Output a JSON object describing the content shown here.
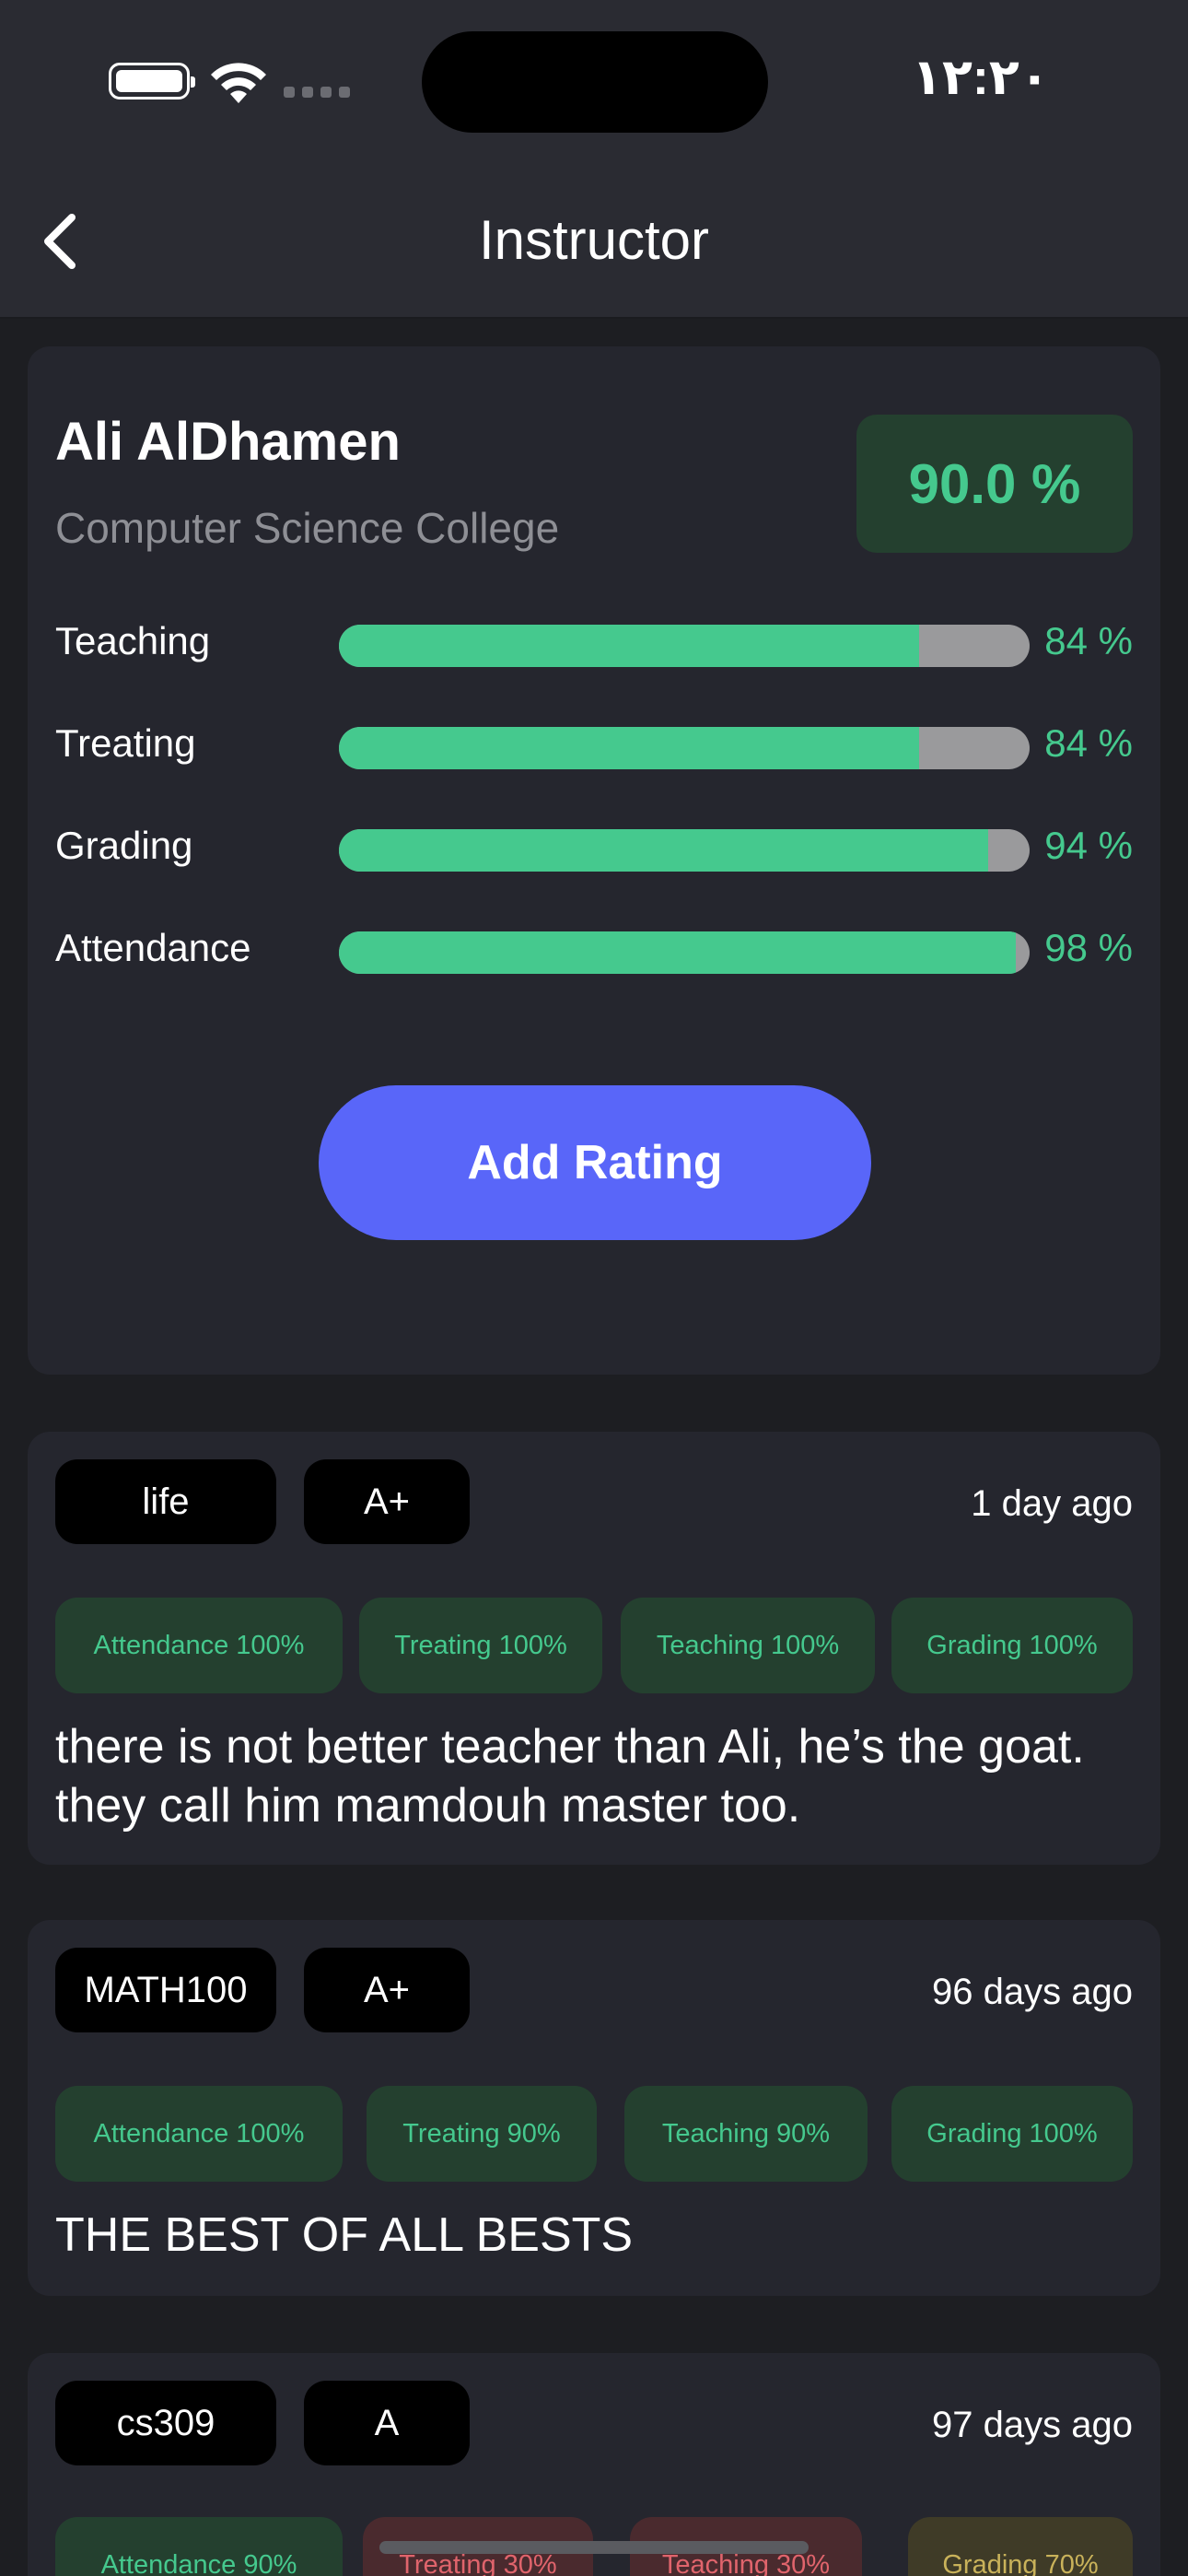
{
  "status_bar": {
    "time": "١٢:٢٠"
  },
  "nav": {
    "title": "Instructor"
  },
  "profile": {
    "name": "Ali AlDhamen",
    "college": "Computer Science College",
    "overall": "90.0 %",
    "metrics": [
      {
        "label": "Teaching",
        "value": "84 %",
        "fraction": 0.84
      },
      {
        "label": "Treating",
        "value": "84 %",
        "fraction": 0.84
      },
      {
        "label": "Grading",
        "value": "94 %",
        "fraction": 0.94
      },
      {
        "label": "Attendance",
        "value": "98 %",
        "fraction": 0.98
      }
    ],
    "add_rating_label": "Add Rating"
  },
  "reviews": [
    {
      "course": "life",
      "grade": "A+",
      "time": "1 day ago",
      "tags": [
        "Attendance 100%",
        "Treating 100%",
        "Teaching 100%",
        "Grading 100%"
      ],
      "text": "there is not better teacher than Ali, he’s the goat. they call him mamdouh master too."
    },
    {
      "course": "MATH100",
      "grade": "A+",
      "time": "96 days ago",
      "tags": [
        "Attendance 100%",
        "Treating 90%",
        "Teaching 90%",
        "Grading 100%"
      ],
      "text": "THE BEST OF ALL BESTS"
    },
    {
      "course": "cs309",
      "grade": "A",
      "time": "97 days ago",
      "tags": [
        "Attendance 90%",
        "Treating 30%",
        "Teaching 30%",
        "Grading 70%"
      ],
      "text": ""
    }
  ],
  "colors": {
    "accent_green": "#45c98e",
    "button_blue": "#5966f9",
    "bad_red": "#e0646c",
    "mid_yellow": "#c9b25a"
  }
}
